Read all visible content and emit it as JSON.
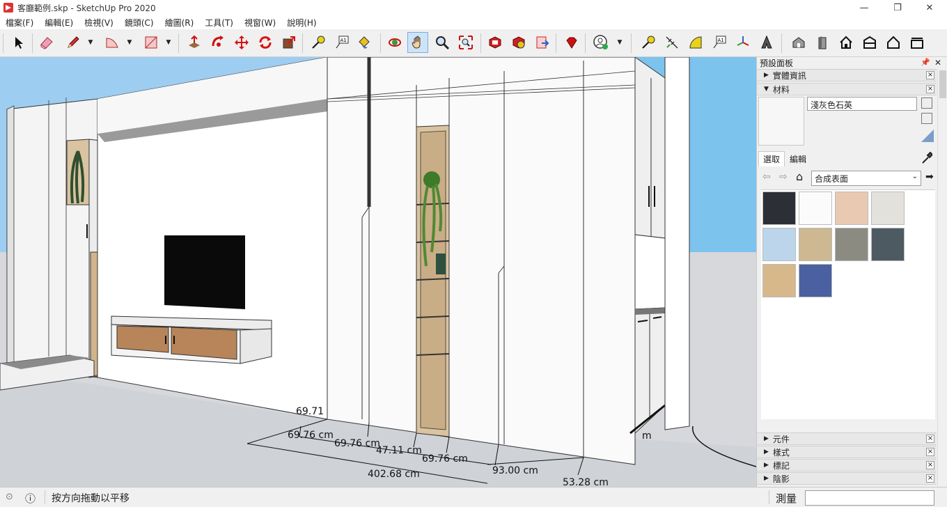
{
  "window": {
    "title": "客廳範例.skp - SketchUp Pro 2020",
    "minimize": "—",
    "maximize": "❐",
    "close": "✕"
  },
  "menu": [
    "檔案(F)",
    "編輯(E)",
    "檢視(V)",
    "鏡頭(C)",
    "繪圖(R)",
    "工具(T)",
    "視窗(W)",
    "說明(H)"
  ],
  "toolbar": {
    "active_tool": "pan-tool",
    "icons": [
      "select-icon",
      "eraser-icon",
      "pencil-icon",
      "arc-icon",
      "rectangle-icon",
      "push-pull-icon",
      "follow-me-icon",
      "move-icon",
      "rotate-icon",
      "scale-icon",
      "tape-measure-icon",
      "text-icon",
      "paint-bucket-icon",
      "orbit-icon",
      "pan-icon",
      "zoom-icon",
      "zoom-extents-icon",
      "warehouse-icon",
      "extension-warehouse-icon",
      "send-to-layout-icon",
      "ruby-icon",
      "account-icon",
      "dimension-icon",
      "protractor-icon",
      "3d-text-icon",
      "axes-icon",
      "section-plane-icon",
      "iso-view-icon",
      "front-view-icon",
      "home-view-icon",
      "right-view-icon",
      "back-view-icon",
      "left-view-icon"
    ]
  },
  "viewport": {
    "dimensions": [
      "69.71",
      "69.76 cm",
      "69.76 cm",
      "47.11 cm",
      "69.76 cm",
      "93.00 cm",
      "402.68 cm",
      "53.28 cm",
      "m"
    ]
  },
  "tray": {
    "title": "預設面板",
    "pin": "📌",
    "close": "✕",
    "panels_top": [
      {
        "label": "實體資訊",
        "expanded": false
      },
      {
        "label": "材料",
        "expanded": true
      }
    ],
    "material": {
      "name": "淺灰色石英",
      "tabs": [
        "選取",
        "編輯"
      ],
      "library": "合成表面",
      "swatch_colors": [
        "#2c2f36",
        "#fbfbfb",
        "#e9c9b1",
        "#e3e1dc",
        "#bcd5ea",
        "#cdb892",
        "#8c8b82",
        "#4e5a62",
        "#d6b88a",
        "#4a60a0"
      ]
    },
    "panels_bottom": [
      {
        "label": "元件"
      },
      {
        "label": "樣式"
      },
      {
        "label": "標記"
      },
      {
        "label": "陰影"
      }
    ]
  },
  "status": {
    "hint": "按方向拖動以平移",
    "measure_label": "測量",
    "measure_value": ""
  }
}
